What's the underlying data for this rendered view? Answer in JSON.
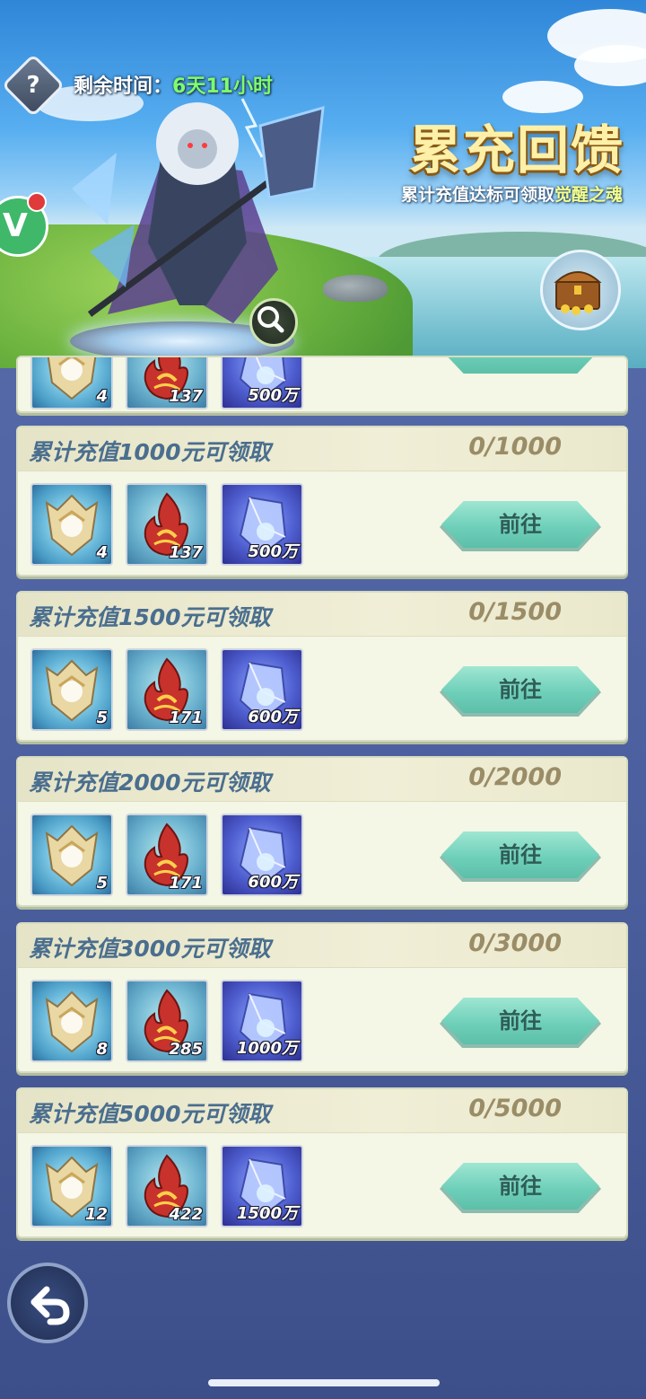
{
  "header": {
    "help_label": "?",
    "timer_label": "剩余时间：",
    "timer_value": "6天11小时",
    "title": "累充回馈",
    "subtitle_prefix": "累计充值达标可领取",
    "subtitle_highlight": "觉醒之魂",
    "badge_letter": "V"
  },
  "colors": {
    "timer_value": "#7dff6c",
    "title_fill": "#fff0a8",
    "button_teal": "#6fd0ba",
    "card_bg": "#f4f6e6",
    "tier_title": "#4a6e8e"
  },
  "icons": [
    "help-icon",
    "zoom-icon",
    "treasure-chest-icon",
    "back-arrow-icon",
    "awakening-soul-icon",
    "fire-crystal-icon",
    "blue-crystal-icon"
  ],
  "partial_row": {
    "items": [
      {
        "icon": "awakening-soul-icon",
        "count": "4"
      },
      {
        "icon": "fire-crystal-icon",
        "count": "137"
      },
      {
        "icon": "blue-crystal-icon",
        "count": "500万"
      }
    ]
  },
  "tiers": [
    {
      "title": "累计充值1000元可领取",
      "progress": "0/1000",
      "button": "前往",
      "items": [
        {
          "icon": "awakening-soul-icon",
          "count": "4"
        },
        {
          "icon": "fire-crystal-icon",
          "count": "137"
        },
        {
          "icon": "blue-crystal-icon",
          "count": "500万"
        }
      ]
    },
    {
      "title": "累计充值1500元可领取",
      "progress": "0/1500",
      "button": "前往",
      "items": [
        {
          "icon": "awakening-soul-icon",
          "count": "5"
        },
        {
          "icon": "fire-crystal-icon",
          "count": "171"
        },
        {
          "icon": "blue-crystal-icon",
          "count": "600万"
        }
      ]
    },
    {
      "title": "累计充值2000元可领取",
      "progress": "0/2000",
      "button": "前往",
      "items": [
        {
          "icon": "awakening-soul-icon",
          "count": "5"
        },
        {
          "icon": "fire-crystal-icon",
          "count": "171"
        },
        {
          "icon": "blue-crystal-icon",
          "count": "600万"
        }
      ]
    },
    {
      "title": "累计充值3000元可领取",
      "progress": "0/3000",
      "button": "前往",
      "items": [
        {
          "icon": "awakening-soul-icon",
          "count": "8"
        },
        {
          "icon": "fire-crystal-icon",
          "count": "285"
        },
        {
          "icon": "blue-crystal-icon",
          "count": "1000万"
        }
      ]
    },
    {
      "title": "累计充值5000元可领取",
      "progress": "0/5000",
      "button": "前往",
      "items": [
        {
          "icon": "awakening-soul-icon",
          "count": "12"
        },
        {
          "icon": "fire-crystal-icon",
          "count": "422"
        },
        {
          "icon": "blue-crystal-icon",
          "count": "1500万"
        }
      ]
    }
  ]
}
